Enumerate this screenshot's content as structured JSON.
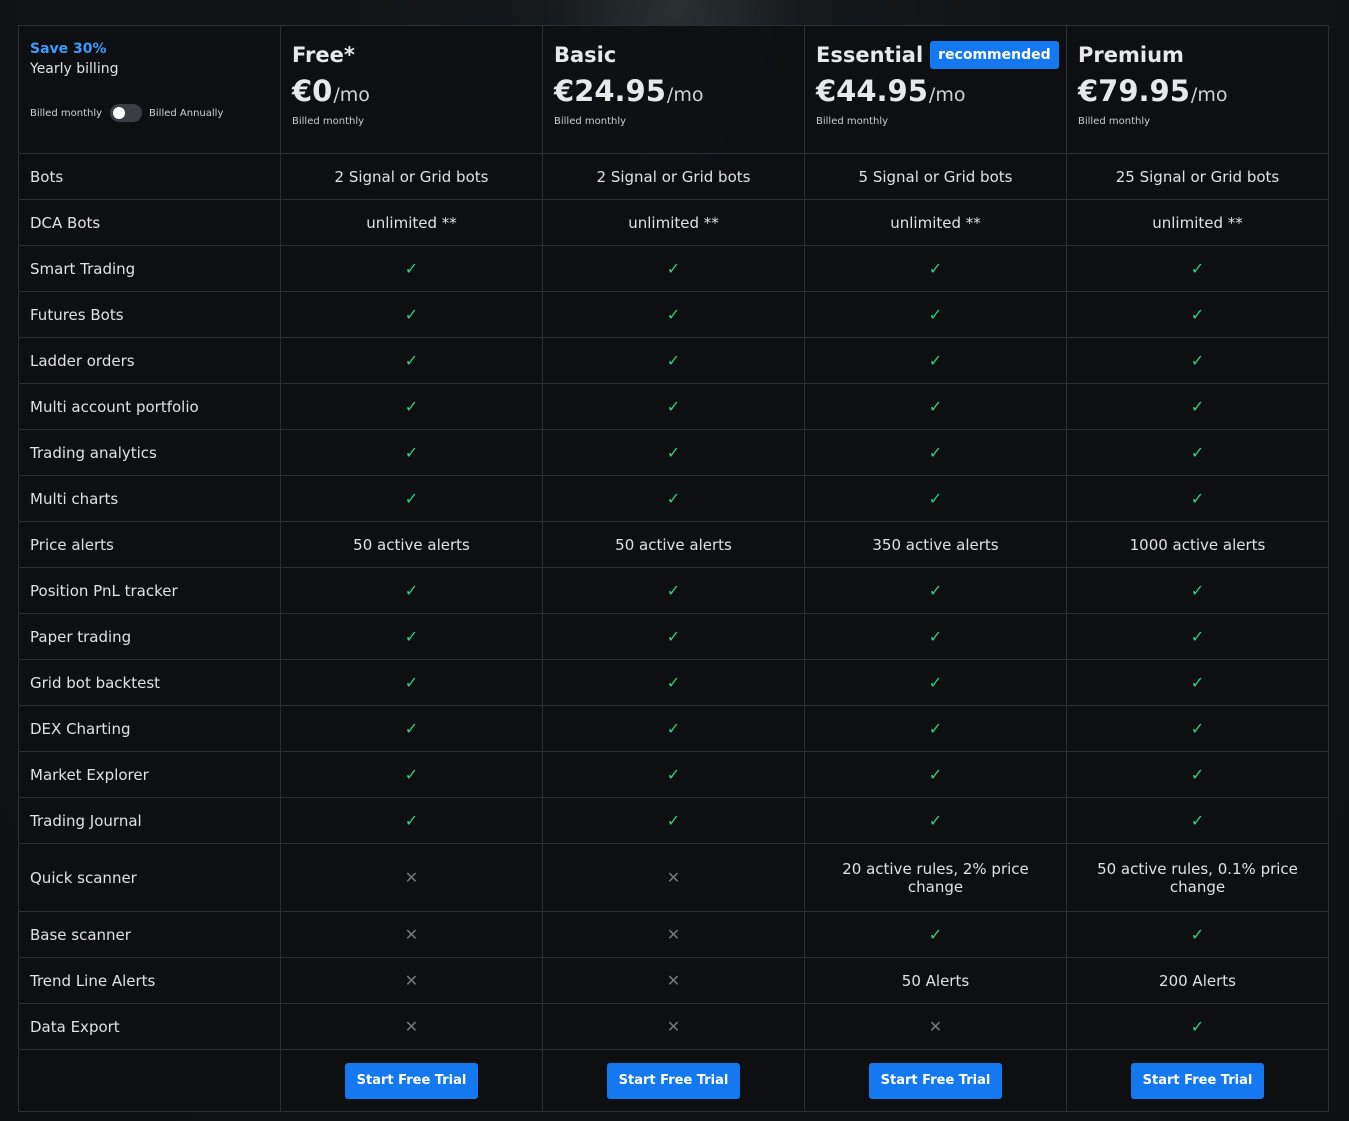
{
  "billing": {
    "save_text": "Save 30%",
    "yearly_text": "Yearly billing",
    "monthly_label": "Billed monthly",
    "annually_label": "Billed Annually"
  },
  "plans": [
    {
      "name": "Free*",
      "price": "€0",
      "unit": "/mo",
      "billed": "Billed monthly"
    },
    {
      "name": "Basic",
      "price": "€24.95",
      "unit": "/mo",
      "billed": "Billed monthly"
    },
    {
      "name": "Essential",
      "price": "€44.95",
      "unit": "/mo",
      "billed": "Billed monthly",
      "badge": "recommended"
    },
    {
      "name": "Premium",
      "price": "€79.95",
      "unit": "/mo",
      "billed": "Billed monthly"
    }
  ],
  "features": [
    {
      "name": "Bots",
      "values": [
        "2 Signal or Grid bots",
        "2 Signal or Grid bots",
        "5 Signal or Grid bots",
        "25 Signal or Grid bots"
      ]
    },
    {
      "name": "DCA Bots",
      "values": [
        "unlimited **",
        "unlimited **",
        "unlimited **",
        "unlimited **"
      ]
    },
    {
      "name": "Smart Trading",
      "values": [
        "check",
        "check",
        "check",
        "check"
      ]
    },
    {
      "name": "Futures Bots",
      "values": [
        "check",
        "check",
        "check",
        "check"
      ]
    },
    {
      "name": "Ladder orders",
      "values": [
        "check",
        "check",
        "check",
        "check"
      ]
    },
    {
      "name": "Multi account portfolio",
      "values": [
        "check",
        "check",
        "check",
        "check"
      ]
    },
    {
      "name": "Trading analytics",
      "values": [
        "check",
        "check",
        "check",
        "check"
      ]
    },
    {
      "name": "Multi charts",
      "values": [
        "check",
        "check",
        "check",
        "check"
      ]
    },
    {
      "name": "Price alerts",
      "values": [
        "50 active alerts",
        "50 active alerts",
        "350 active alerts",
        "1000 active alerts"
      ]
    },
    {
      "name": "Position PnL tracker",
      "values": [
        "check",
        "check",
        "check",
        "check"
      ]
    },
    {
      "name": "Paper trading",
      "values": [
        "check",
        "check",
        "check",
        "check"
      ]
    },
    {
      "name": "Grid bot backtest",
      "values": [
        "check",
        "check",
        "check",
        "check"
      ]
    },
    {
      "name": "DEX Charting",
      "values": [
        "check",
        "check",
        "check",
        "check"
      ]
    },
    {
      "name": "Market Explorer",
      "values": [
        "check",
        "check",
        "check",
        "check"
      ]
    },
    {
      "name": "Trading Journal",
      "values": [
        "check",
        "check",
        "check",
        "check"
      ]
    },
    {
      "name": "Quick scanner",
      "values": [
        "cross",
        "cross",
        "20 active rules, 2% price change",
        "50 active rules, 0.1% price change"
      ]
    },
    {
      "name": "Base scanner",
      "values": [
        "cross",
        "cross",
        "check",
        "check"
      ]
    },
    {
      "name": "Trend Line Alerts",
      "values": [
        "cross",
        "cross",
        "50 Alerts",
        "200 Alerts"
      ]
    },
    {
      "name": "Data Export",
      "values": [
        "cross",
        "cross",
        "cross",
        "check"
      ]
    }
  ],
  "cta_label": "Start Free Trial",
  "icons": {
    "check": "check-icon",
    "cross": "cross-icon"
  },
  "colors": {
    "accent": "#1479f0",
    "check": "#2fcf80",
    "cross": "#73777d",
    "save": "#3d9bff"
  }
}
